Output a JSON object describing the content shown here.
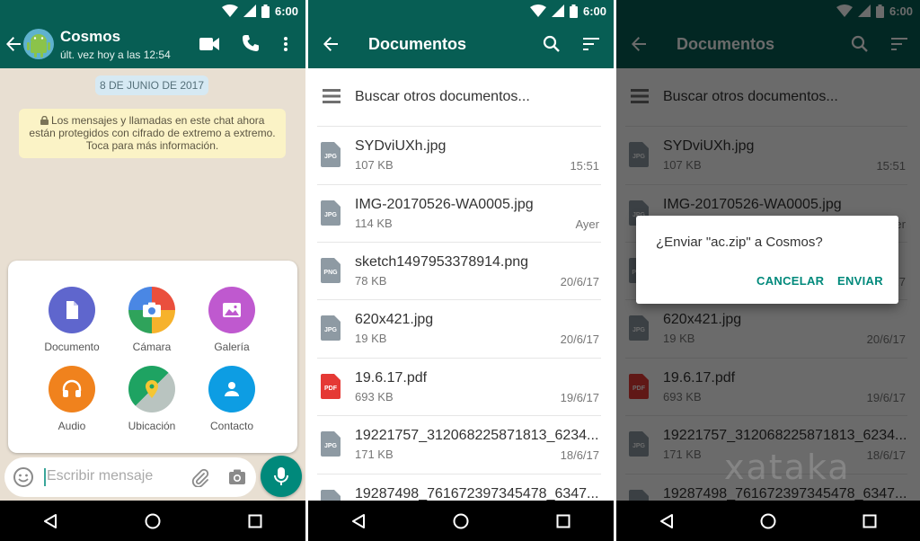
{
  "status": {
    "time": "6:00"
  },
  "chat": {
    "contact_name": "Cosmos",
    "last_seen": "últ. vez hoy a las 12:54",
    "date_chip": "8 DE JUNIO DE 2017",
    "encryption_notice": [
      "Los mensajes y llamadas en este chat ahora",
      "están protegidos con cifrado de extremo a extremo.",
      "Toca para más información."
    ],
    "attach_options": [
      {
        "label": "Documento",
        "icon": "document-icon",
        "color": "#5f66cd"
      },
      {
        "label": "Cámara",
        "icon": "camera-icon",
        "color": "#ea4f3d"
      },
      {
        "label": "Galería",
        "icon": "gallery-icon",
        "color": "#bf59cf"
      },
      {
        "label": "Audio",
        "icon": "headphones-icon",
        "color": "#f0821d"
      },
      {
        "label": "Ubicación",
        "icon": "location-icon",
        "color": "#1ea362"
      },
      {
        "label": "Contacto",
        "icon": "contact-icon",
        "color": "#0d9de3"
      }
    ],
    "composer_placeholder": "Escribir mensaje"
  },
  "documents": {
    "title": "Documentos",
    "search_other": "Buscar otros documentos...",
    "files": [
      {
        "name": "SYDviUXh.jpg",
        "size": "107 KB",
        "date": "15:51",
        "type": "JPG"
      },
      {
        "name": "IMG-20170526-WA0005.jpg",
        "size": "114 KB",
        "date": "Ayer",
        "type": "JPG"
      },
      {
        "name": "sketch1497953378914.png",
        "size": "78 KB",
        "date": "20/6/17",
        "type": "PNG"
      },
      {
        "name": "620x421.jpg",
        "size": "19 KB",
        "date": "20/6/17",
        "type": "JPG"
      },
      {
        "name": "19.6.17.pdf",
        "size": "693 KB",
        "date": "19/6/17",
        "type": "PDF"
      },
      {
        "name": "19221757_312068225871813_6234...",
        "size": "171 KB",
        "date": "18/6/17",
        "type": "JPG"
      },
      {
        "name": "19287498_761672397345478_6347...",
        "size": "",
        "date": "",
        "type": "JPG"
      }
    ]
  },
  "dialog": {
    "message": "¿Enviar \"ac.zip\" a Cosmos?",
    "cancel": "CANCELAR",
    "send": "ENVIAR"
  },
  "watermark": "xataka",
  "colors": {
    "whatsapp_teal": "#075e54",
    "accent_green": "#00897b",
    "file_grey": "#8e9aa3",
    "pdf_red": "#e53935"
  }
}
